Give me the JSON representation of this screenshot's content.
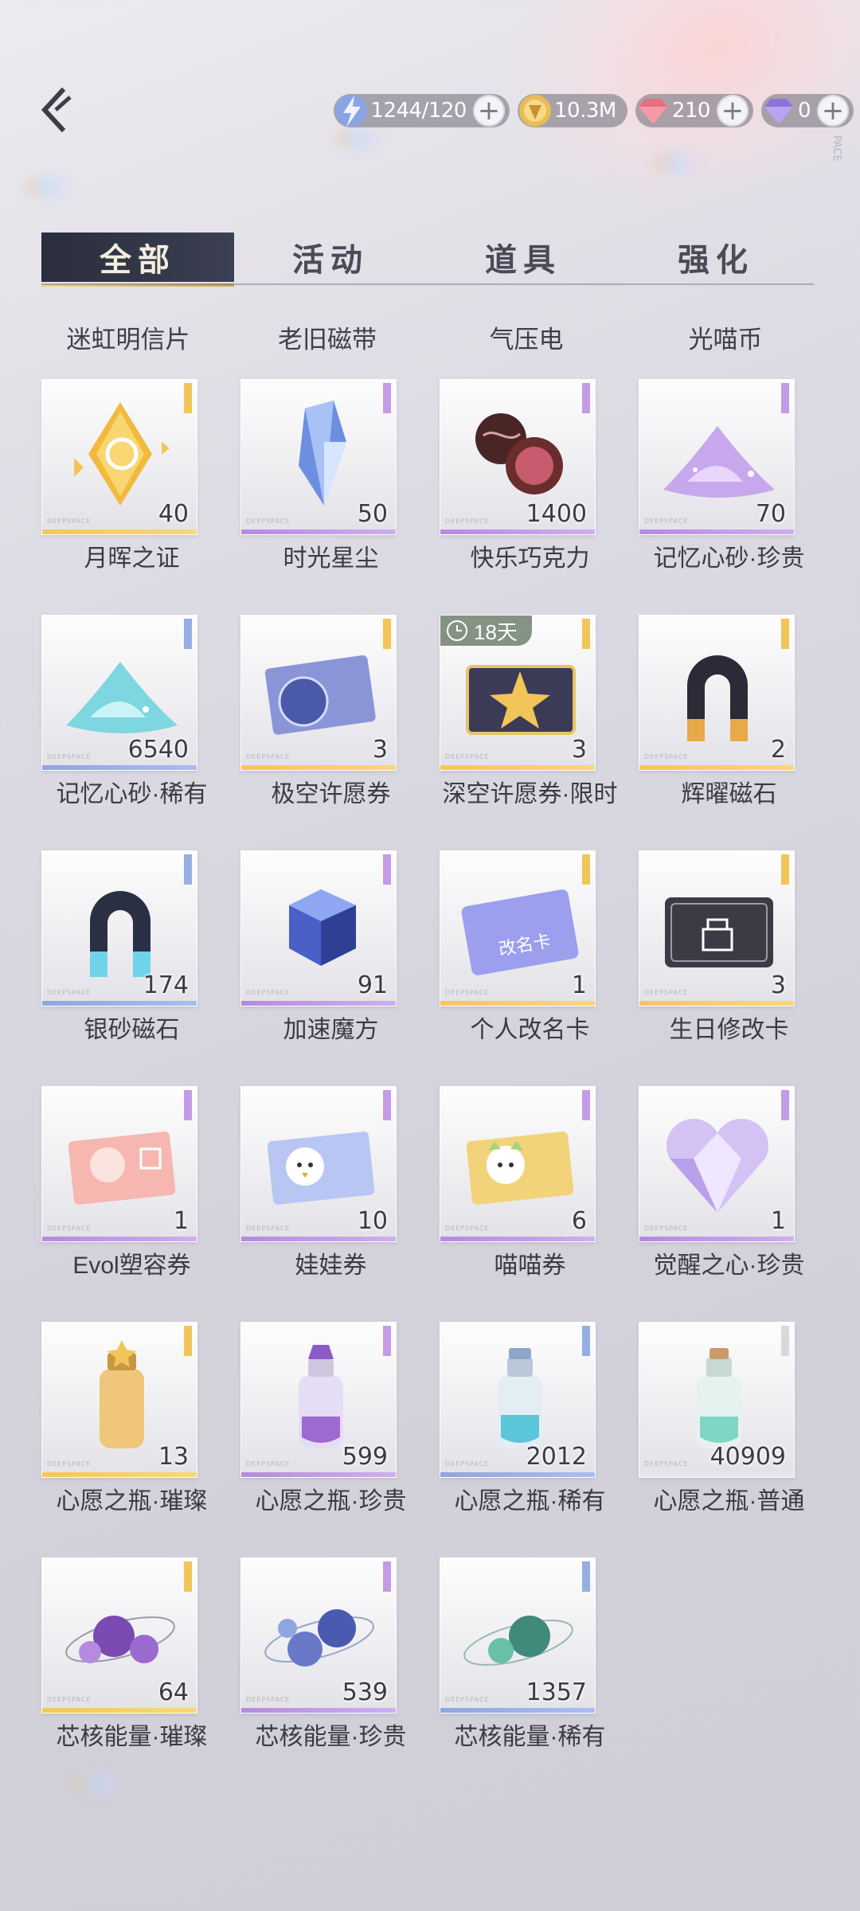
{
  "header": {
    "back_icon": "back-arrow-icon",
    "resources": [
      {
        "name": "stamina",
        "icon": "lightning-icon",
        "value": "1244/120",
        "color": "#6f8fd8"
      },
      {
        "name": "gold",
        "icon": "gold-coin-icon",
        "value": "10.3M",
        "color": "#e6b84a"
      },
      {
        "name": "red-gem",
        "icon": "red-diamond-icon",
        "value": "210",
        "color": "#e46a7a"
      },
      {
        "name": "purple-gem",
        "icon": "purple-diamond-icon",
        "value": "0",
        "color": "#9a7ae0"
      }
    ]
  },
  "tabs": [
    {
      "label": "全部",
      "active": true
    },
    {
      "label": "活动",
      "active": false
    },
    {
      "label": "道具",
      "active": false
    },
    {
      "label": "强化",
      "active": false
    }
  ],
  "top_labels": [
    "迷虹明信片",
    "老旧磁带",
    "气压电",
    "光喵币"
  ],
  "items": [
    {
      "name": "月晖之证",
      "qty": "40",
      "rarity": "gold",
      "icon": "gold-crescent-badge-icon"
    },
    {
      "name": "时光星尘",
      "qty": "50",
      "rarity": "purple",
      "icon": "blue-crystal-icon"
    },
    {
      "name": "快乐巧克力",
      "qty": "1400",
      "rarity": "purple",
      "icon": "chocolate-icon"
    },
    {
      "name": "记忆心砂·珍贵",
      "qty": "70",
      "rarity": "purple",
      "icon": "purple-sand-pile-icon"
    },
    {
      "name": "记忆心砂·稀有",
      "qty": "6540",
      "rarity": "blue",
      "icon": "cyan-sand-pile-icon"
    },
    {
      "name": "极空许愿券",
      "qty": "3",
      "rarity": "gold",
      "icon": "planet-ticket-icon"
    },
    {
      "name": "深空许愿券·限时",
      "qty": "3",
      "rarity": "gold",
      "icon": "star-ticket-icon",
      "timer": "18天"
    },
    {
      "name": "辉曜磁石",
      "qty": "2",
      "rarity": "gold",
      "icon": "gold-magnet-icon"
    },
    {
      "name": "银砂磁石",
      "qty": "174",
      "rarity": "blue",
      "icon": "blue-magnet-icon"
    },
    {
      "name": "加速魔方",
      "qty": "91",
      "rarity": "purple",
      "icon": "cube-icon"
    },
    {
      "name": "个人改名卡",
      "qty": "1",
      "rarity": "gold",
      "icon": "rename-card-icon",
      "card_text": "改名卡"
    },
    {
      "name": "生日修改卡",
      "qty": "3",
      "rarity": "gold",
      "icon": "birthday-card-icon"
    },
    {
      "name": "Evol塑容券",
      "qty": "1",
      "rarity": "purple",
      "icon": "face-ticket-icon"
    },
    {
      "name": "娃娃券",
      "qty": "10",
      "rarity": "purple",
      "icon": "doll-ticket-icon"
    },
    {
      "name": "喵喵券",
      "qty": "6",
      "rarity": "purple",
      "icon": "cat-ticket-icon"
    },
    {
      "name": "觉醒之心·珍贵",
      "qty": "1",
      "rarity": "purple",
      "icon": "crystal-heart-icon"
    },
    {
      "name": "心愿之瓶·璀璨",
      "qty": "13",
      "rarity": "gold",
      "icon": "gold-bottle-icon"
    },
    {
      "name": "心愿之瓶·珍贵",
      "qty": "599",
      "rarity": "purple",
      "icon": "purple-bottle-icon"
    },
    {
      "name": "心愿之瓶·稀有",
      "qty": "2012",
      "rarity": "blue",
      "icon": "blue-bottle-icon"
    },
    {
      "name": "心愿之瓶·普通",
      "qty": "40909",
      "rarity": "plain",
      "icon": "green-bottle-icon"
    },
    {
      "name": "芯核能量·璀璨",
      "qty": "64",
      "rarity": "gold",
      "icon": "purple-orbs-icon"
    },
    {
      "name": "芯核能量·珍贵",
      "qty": "539",
      "rarity": "purple",
      "icon": "blue-orbs-icon"
    },
    {
      "name": "芯核能量·稀有",
      "qty": "1357",
      "rarity": "blue",
      "icon": "green-orbs-icon"
    }
  ],
  "deco": {
    "card_watermark": "DEEPSPACE",
    "side_mark": "PACE"
  }
}
